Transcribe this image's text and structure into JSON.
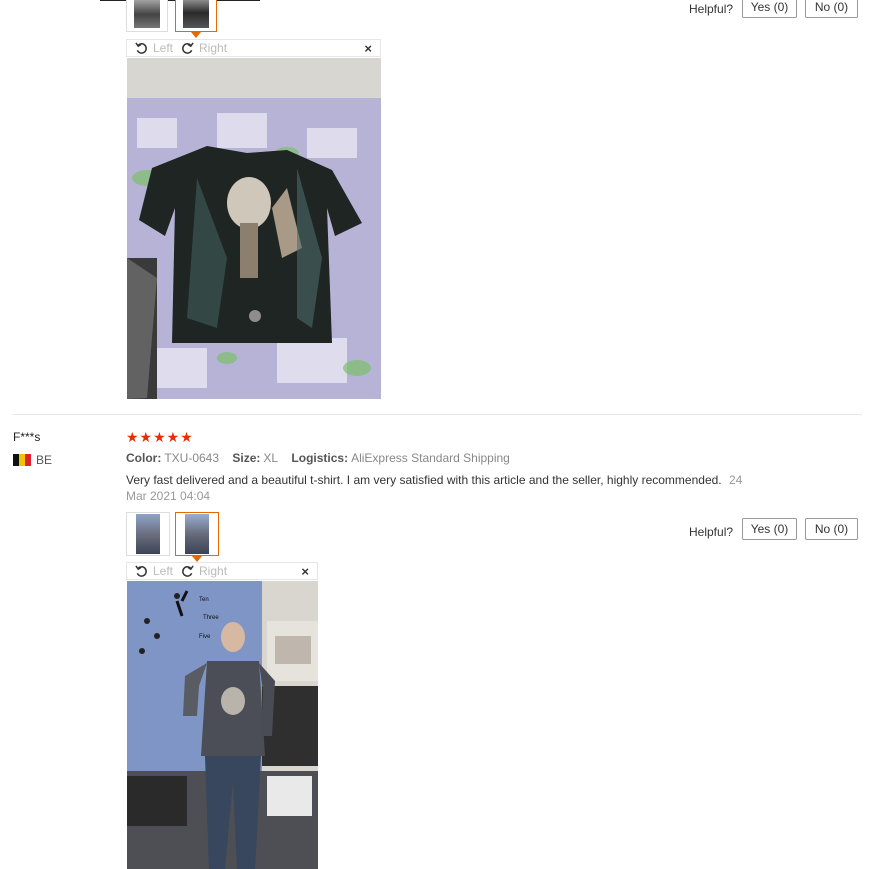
{
  "review1": {
    "tools": {
      "left": "Left",
      "right": "Right",
      "close": "×"
    },
    "helpful_label": "Helpful?",
    "yes_label": "Yes (0)",
    "no_label": "No (0)"
  },
  "review2": {
    "user_name": "F***s",
    "country": "BE",
    "stars": "★★★★★",
    "meta": {
      "color_label": "Color:",
      "color_value": "TXU-0643",
      "size_label": "Size:",
      "size_value": "XL",
      "logistics_label": "Logistics:",
      "logistics_value": "AliExpress Standard Shipping"
    },
    "text": "Very fast delivered and a beautiful t-shirt. I am very satisfied with this article and the seller, highly recommended.",
    "date_part1": "24",
    "date_part2": "Mar 2021 04:04",
    "tools": {
      "left": "Left",
      "right": "Right",
      "close": "×"
    },
    "helpful_label": "Helpful?",
    "yes_label": "Yes (0)",
    "no_label": "No (0)"
  },
  "colors": {
    "accent": "#e46a00",
    "star": "#e62e04"
  }
}
